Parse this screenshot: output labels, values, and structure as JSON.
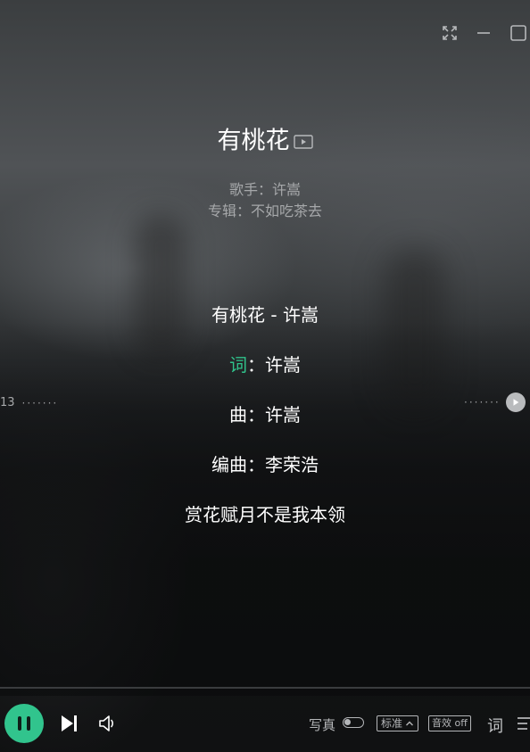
{
  "window": {
    "fullscreen_icon": "fullscreen-icon",
    "minimize_icon": "minimize-icon",
    "maximize_icon": "maximize-icon"
  },
  "song": {
    "title": "有桃花",
    "mv_icon": "mv-play-icon",
    "artist_line": "歌手：许嵩",
    "album_line": "专辑：不如吃茶去"
  },
  "lyrics": {
    "line1": "有桃花 - 许嵩",
    "line2_prefix": "词",
    "line2_rest": "：许嵩",
    "line3": "曲：许嵩",
    "line4": "编曲：李荣浩",
    "line5": "赏花赋月不是我本领"
  },
  "seek": {
    "left_time": "13",
    "dots": "·······",
    "right_play_icon": "seek-play-icon"
  },
  "controls": {
    "play_pause_icon": "pause-icon",
    "next_icon": "next-track-icon",
    "volume_icon": "volume-icon",
    "photo_label": "写真",
    "photo_toggle": "off",
    "quality_label": "标准",
    "effect_label": "音效 off",
    "lyric_label": "词",
    "playlist_icon": "playlist-icon"
  },
  "colors": {
    "accent": "#31c48d",
    "lyric_highlight": "#30c48c",
    "text_primary": "#ffffff",
    "text_secondary": "#a6a8aa"
  }
}
